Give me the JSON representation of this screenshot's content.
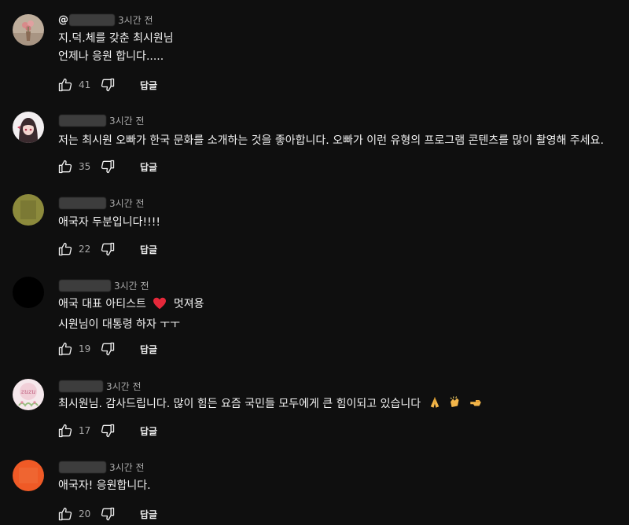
{
  "comments": [
    {
      "handle_prefix": "@",
      "time": "3시간 전",
      "lines": [
        "지.덕.체를 갖춘 최시원님",
        "언제나 응원 합니다....."
      ],
      "likes": "41",
      "reply": "답글",
      "avatar": "flower-vase-avatar"
    },
    {
      "handle_prefix": "@",
      "time": "3시간 전",
      "lines": [
        "저는 최시원 오빠가 한국 문화를 소개하는 것을 좋아합니다. 오빠가 이런 유형의 프로그램 콘텐츠를 많이 촬영해 주세요."
      ],
      "likes": "35",
      "reply": "답글",
      "avatar": "anime-girl-avatar"
    },
    {
      "handle_prefix": "@",
      "time": "3시간 전",
      "lines": [
        "애국자 두분입니다!!!!"
      ],
      "likes": "22",
      "reply": "답글",
      "avatar": "olive-square-avatar"
    },
    {
      "handle_prefix": "@",
      "time": "3시간 전",
      "lines": [
        "애국 대표 아티스트",
        "시원님이 대통령 하자 ㅜㅜ"
      ],
      "line1_suffix": "멋져용",
      "likes": "19",
      "reply": "답글",
      "avatar": "black-avatar"
    },
    {
      "handle_prefix": "@",
      "time": "3시간 전",
      "lines": [
        "최시원님. 감사드립니다. 많이 힘든 요즘 국민들 모두에게 큰 힘이되고 있습니다"
      ],
      "likes": "17",
      "reply": "답글",
      "avatar": "zuzu-flower-avatar",
      "avatar_text": "zuzu"
    },
    {
      "handle_prefix": "@",
      "time": "3시간 전",
      "lines": [
        "애국자! 응원합니다."
      ],
      "likes": "20",
      "reply": "답글",
      "avatar": "orange-avatar"
    }
  ],
  "colors": {
    "background": "#0f0f0f",
    "text": "#f1f1f1",
    "muted": "#aaaaaa"
  },
  "icons": {
    "like": "thumb-up-icon",
    "dislike": "thumb-down-icon",
    "heart": "red-heart-emoji",
    "pray": "folded-hands-emoji",
    "clap": "clapping-hands-emoji",
    "point": "pointing-hand-emoji"
  }
}
